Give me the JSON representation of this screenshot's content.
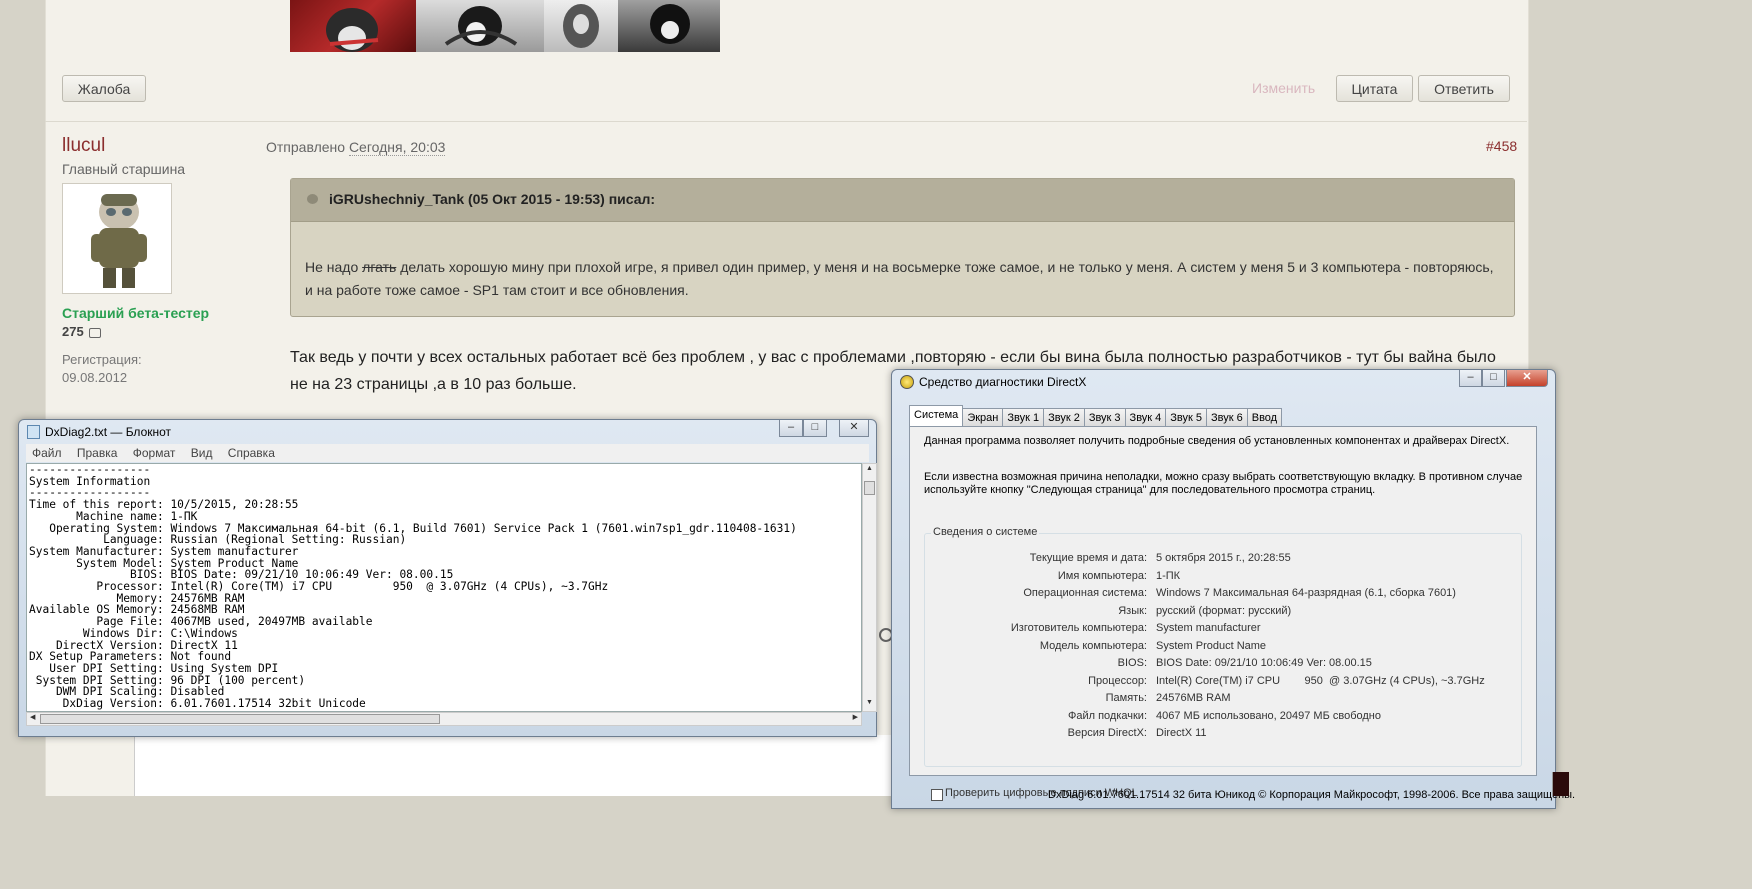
{
  "forum": {
    "buttons": {
      "report": "Жалоба",
      "edit": "Изменить",
      "quote": "Цитата",
      "reply": "Ответить"
    },
    "author": {
      "name": "llucul",
      "rank": "Главный старшина",
      "group": "Старший бета-тестер",
      "post_count": "275",
      "registration_label": "Регистрация:",
      "registration_date": "09.08.2012"
    },
    "post": {
      "meta_prefix": "Отправлено",
      "time": "Сегодня, 20:03",
      "number": "#458",
      "quote_header": "iGRUshechniy_Tank (05 Окт 2015 - 19:53) писал:",
      "quote_pre": "Не надо ",
      "quote_strike": "лгать",
      "quote_post": " делать хорошую мину при плохой игре, я привел один пример, у меня и на восьмерке тоже самое, и не только у меня. А систем у меня 5 и 3 компьютера - повторяюсь, и на работе тоже самое - SP1 там стоит и все обновления.",
      "body": "Так ведь у почти у всех остальных работает всё без проблем , у вас с проблемами ,повторяю - если бы вина была полностью разработчиков - тут бы вайна было не на 23 страницы ,а в 10 раз больше."
    }
  },
  "notepad": {
    "title": "DxDiag2.txt — Блокнот",
    "menu": [
      "Файл",
      "Правка",
      "Формат",
      "Вид",
      "Справка"
    ],
    "lines": [
      "------------------",
      "System Information",
      "------------------",
      "Time of this report: 10/5/2015, 20:28:55",
      "       Machine name: 1-ПК",
      "   Operating System: Windows 7 Максимальная 64-bit (6.1, Build 7601) Service Pack 1 (7601.win7sp1_gdr.110408-1631)",
      "           Language: Russian (Regional Setting: Russian)",
      "System Manufacturer: System manufacturer",
      "       System Model: System Product Name",
      "               BIOS: BIOS Date: 09/21/10 10:06:49 Ver: 08.00.15",
      "          Processor: Intel(R) Core(TM) i7 CPU         950  @ 3.07GHz (4 CPUs), ~3.7GHz",
      "             Memory: 24576MB RAM",
      "Available OS Memory: 24568MB RAM",
      "          Page File: 4067MB used, 20497MB available",
      "        Windows Dir: C:\\Windows",
      "    DirectX Version: DirectX 11",
      "DX Setup Parameters: Not found",
      "   User DPI Setting: Using System DPI",
      " System DPI Setting: 96 DPI (100 percent)",
      "    DWM DPI Scaling: Disabled",
      "     DxDiag Version: 6.01.7601.17514 32bit Unicode"
    ]
  },
  "dxdiag": {
    "title": "Средство диагностики DirectX",
    "tabs": [
      "Система",
      "Экран",
      "Звук 1",
      "Звук 2",
      "Звук 3",
      "Звук 4",
      "Звук 5",
      "Звук 6",
      "Ввод"
    ],
    "intro1": "Данная программа позволяет получить подробные сведения об установленных компонентах и драйверах DirectX.",
    "intro2": "Если известна возможная причина неполадки, можно сразу выбрать соответствующую вкладку. В противном случае используйте кнопку \"Следующая страница\" для последовательного просмотра страниц.",
    "group_title": "Сведения о системе",
    "rows": [
      {
        "label": "Текущие время и дата:",
        "value": "5 октября 2015 г., 20:28:55"
      },
      {
        "label": "Имя компьютера:",
        "value": "1-ПК"
      },
      {
        "label": "Операционная система:",
        "value": "Windows 7 Максимальная 64-разрядная (6.1, сборка 7601)"
      },
      {
        "label": "Язык:",
        "value": "русский (формат: русский)"
      },
      {
        "label": "Изготовитель компьютера:",
        "value": "System manufacturer"
      },
      {
        "label": "Модель компьютера:",
        "value": "System Product Name"
      },
      {
        "label": "BIOS:",
        "value": "BIOS Date: 09/21/10 10:06:49 Ver: 08.00.15"
      },
      {
        "label": "Процессор:",
        "value": "Intel(R) Core(TM) i7 CPU        950  @ 3.07GHz (4 CPUs), ~3.7GHz"
      },
      {
        "label": "Память:",
        "value": "24576MB RAM"
      },
      {
        "label": "Файл подкачки:",
        "value": "4067 МБ использовано, 20497 МБ свободно"
      },
      {
        "label": "Версия DirectX:",
        "value": "DirectX 11"
      }
    ],
    "whql_label": "Проверить цифровые подписи WHQL",
    "footer": "DxDiag 6.01.7601.17514 32 бита Юникод  © Корпорация Майкрософт, 1998-2006.  Все права защищены."
  }
}
